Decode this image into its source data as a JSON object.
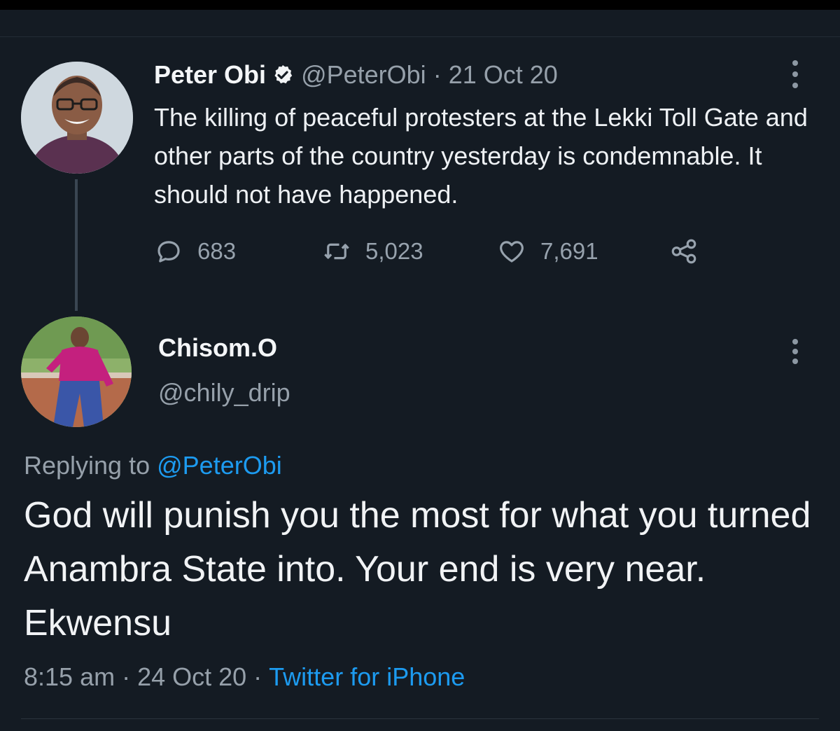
{
  "parent_tweet": {
    "name": "Peter Obi",
    "handle": "@PeterObi",
    "separator": "·",
    "date": "21 Oct 20",
    "text": "The killing of peaceful protesters at the Lekki Toll Gate and other parts of the country yesterday is condemnable. It should not have happened.",
    "replies": "683",
    "retweets": "5,023",
    "likes": "7,691",
    "icons": [
      "verified-badge-icon",
      "more-icon",
      "reply-icon",
      "retweet-icon",
      "like-icon",
      "share-icon"
    ]
  },
  "reply_tweet": {
    "name": "Chisom.O",
    "handle": "@chily_drip",
    "replying_prefix": "Replying to",
    "replying_to": "@PeterObi",
    "text": "God will punish you the most for what you turned Anambra State into. Your end is very near. Ekwensu",
    "time": "8:15 am",
    "separator": "·",
    "date": "24 Oct 20",
    "source": "Twitter for iPhone",
    "icons": [
      "more-icon"
    ]
  },
  "colors": {
    "background": "#141b23",
    "text": "#eef1f4",
    "secondary_text": "#96a0aa",
    "link": "#1d9bf0",
    "verified": "#1d9bf0"
  }
}
